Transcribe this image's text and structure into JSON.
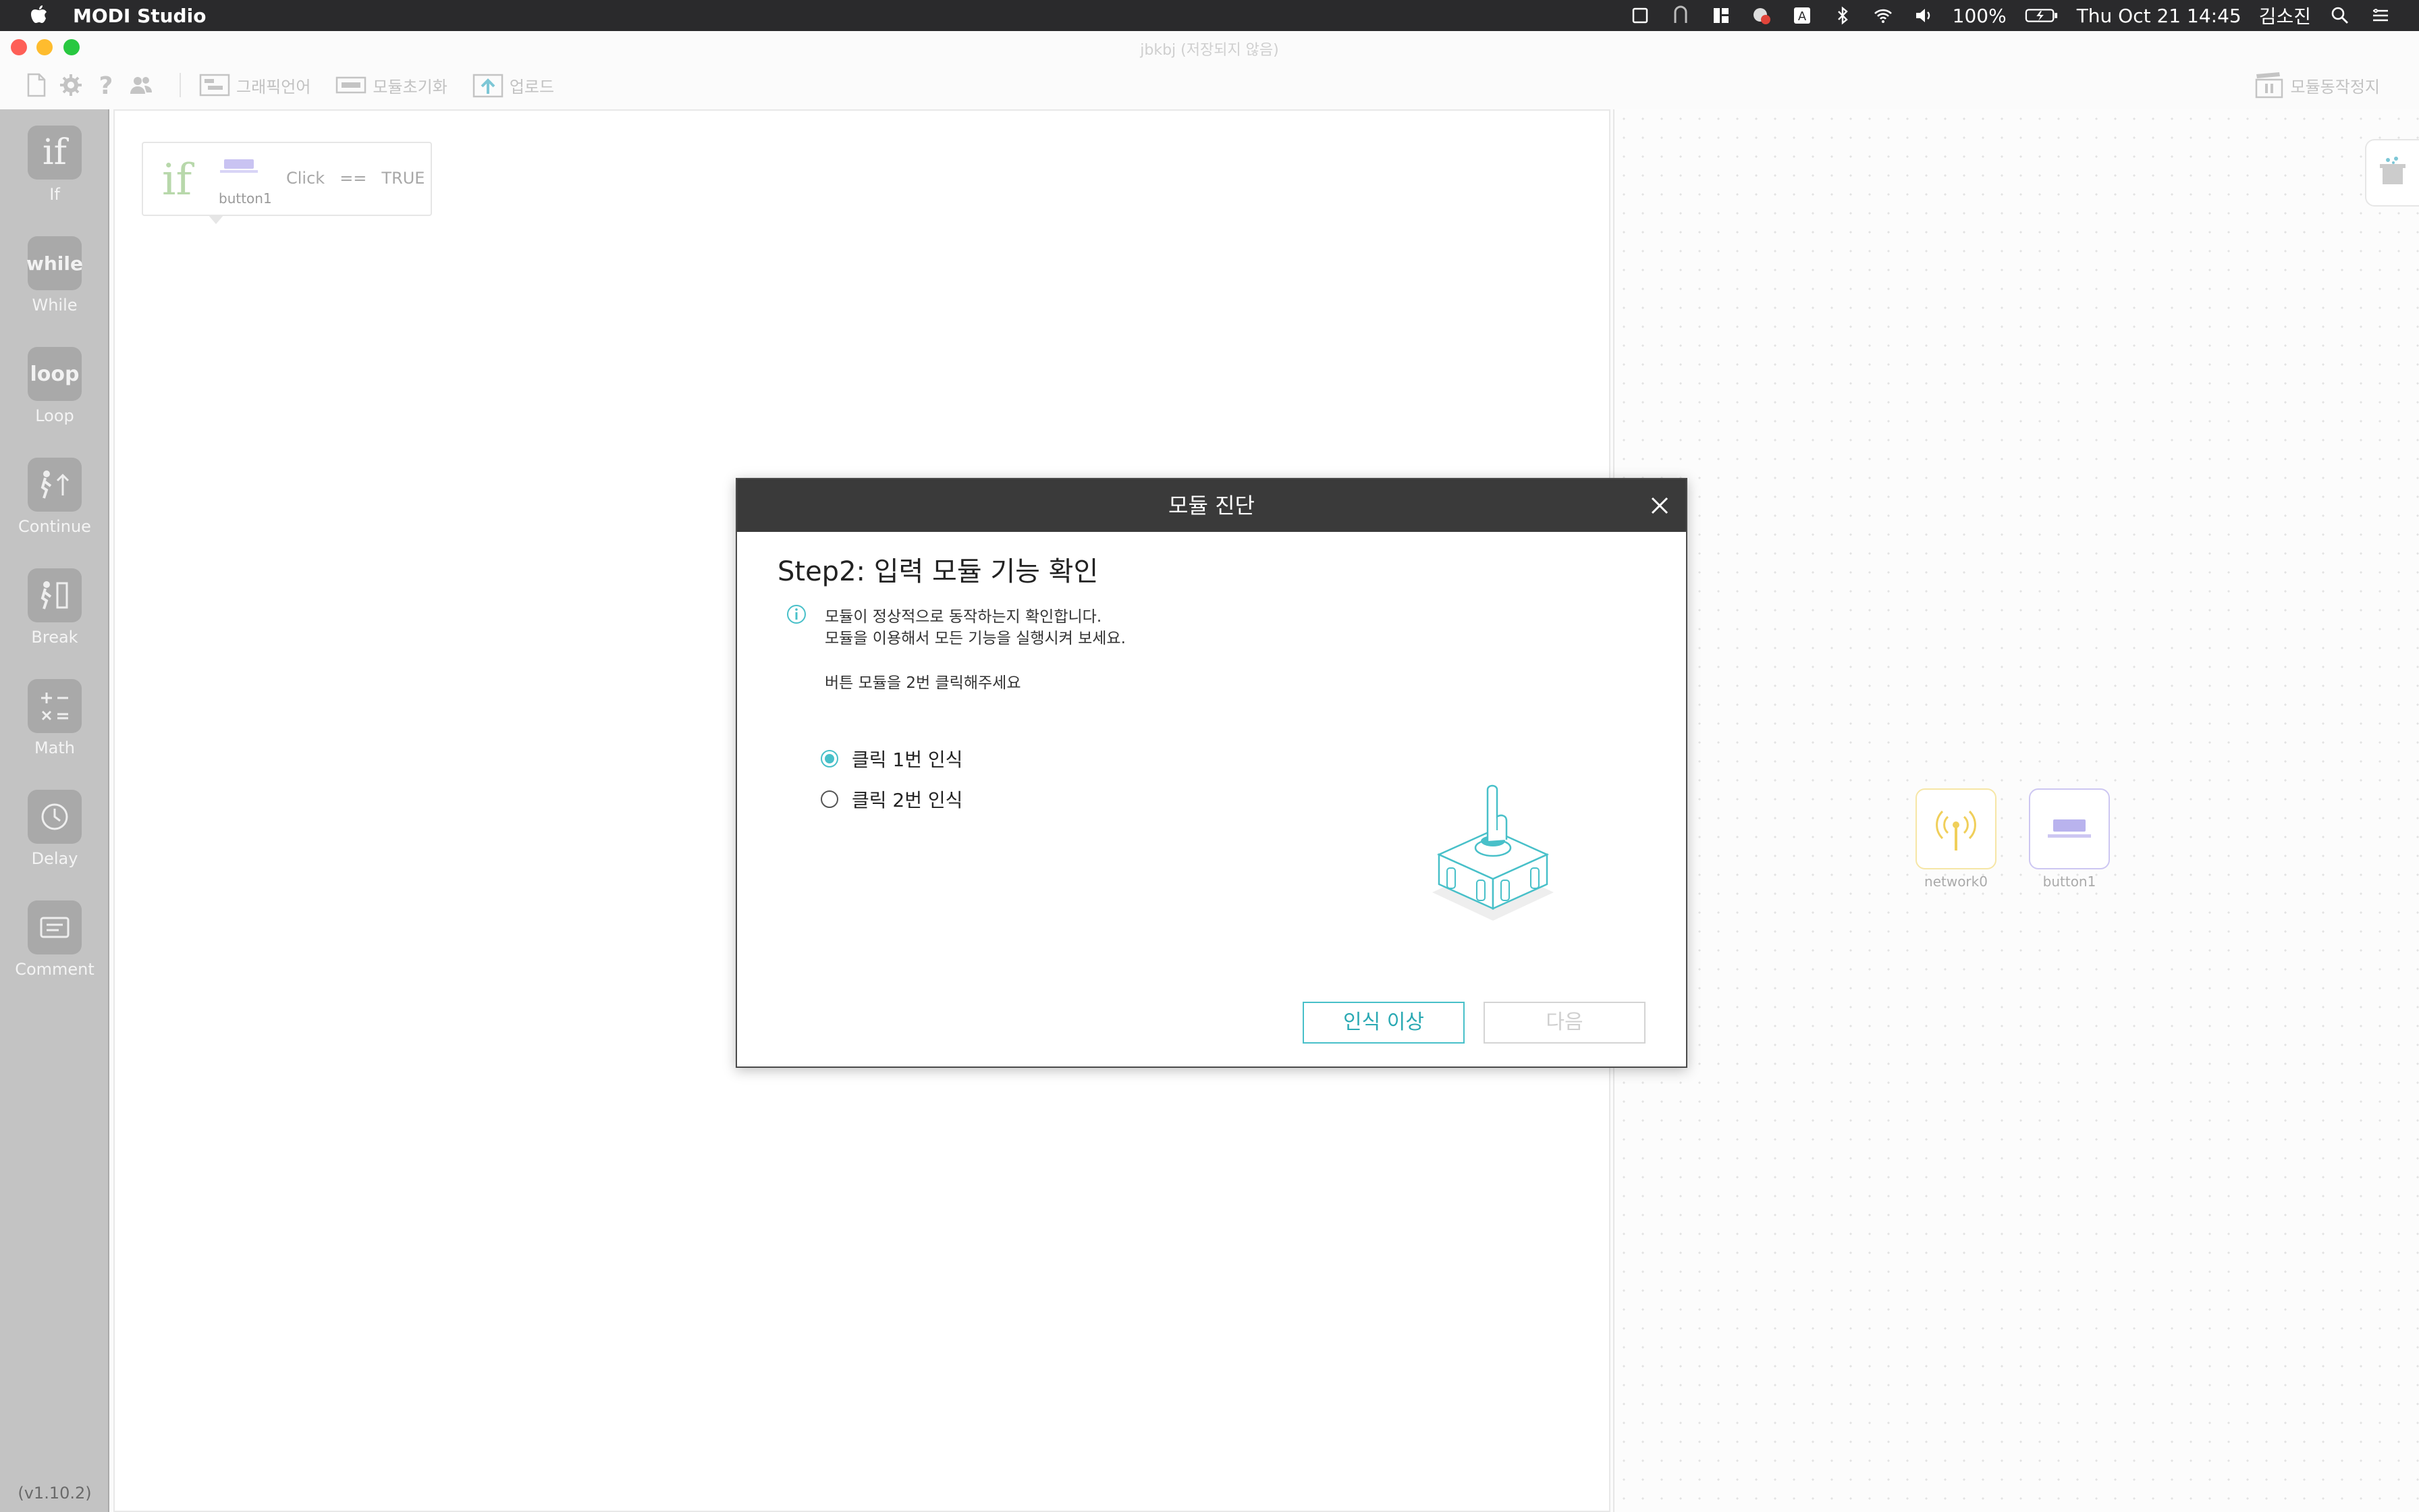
{
  "menubar": {
    "app_name": "MODI Studio",
    "battery": "100%",
    "datetime": "Thu Oct 21  14:45",
    "user": "김소진",
    "input_badge": "A"
  },
  "window": {
    "title": "jbkbj (저장되지 않음)"
  },
  "toolbar": {
    "graphic_language": "그래픽언어",
    "module_reset": "모듈초기화",
    "upload": "업로드",
    "module_stop": "모듈동작정지"
  },
  "palette": {
    "items": [
      {
        "label": "If",
        "glyph": "if"
      },
      {
        "label": "While",
        "glyph": "while"
      },
      {
        "label": "Loop",
        "glyph": "loop"
      },
      {
        "label": "Continue",
        "glyph": ""
      },
      {
        "label": "Break",
        "glyph": ""
      },
      {
        "label": "Math",
        "glyph": ""
      },
      {
        "label": "Delay",
        "glyph": ""
      },
      {
        "label": "Comment",
        "glyph": ""
      }
    ],
    "version": "(v1.10.2)"
  },
  "code_block": {
    "keyword": "if",
    "module": "button1",
    "property": "Click",
    "operator": "==",
    "value": "TRUE"
  },
  "modules": [
    {
      "name": "network0",
      "color": "#f6d76a"
    },
    {
      "name": "button1",
      "color": "#b9b3ee"
    }
  ],
  "dialog": {
    "header": "모듈 진단",
    "title": "Step2: 입력 모듈 기능 확인",
    "info_line1": "모듈이 정상적으로 동작하는지 확인합니다.",
    "info_line2": "모듈을 이용해서 모든 기능을 실행시켜 보세요.",
    "instruction": "버튼 모듈을 2번 클릭해주세요",
    "options": [
      {
        "label": "클릭 1번 인식",
        "checked": true
      },
      {
        "label": "클릭 2번 인식",
        "checked": false
      }
    ],
    "btn_issue": "인식 이상",
    "btn_next": "다음",
    "accent": "#48c0c9"
  }
}
